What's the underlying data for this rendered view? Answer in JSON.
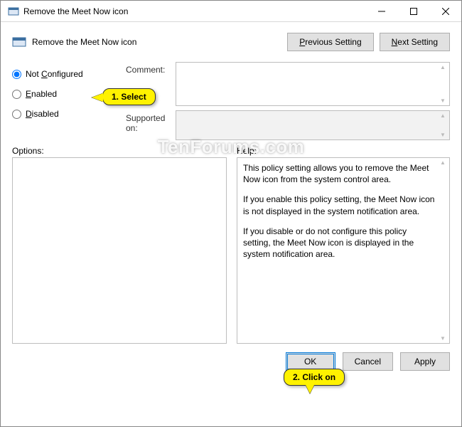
{
  "window": {
    "title": "Remove the Meet Now icon"
  },
  "header": {
    "setting_title": "Remove the Meet Now icon",
    "prev": "Previous Setting",
    "next": "Next Setting"
  },
  "radios": {
    "not_configured": "Not Configured",
    "enabled": "Enabled",
    "disabled": "Disabled",
    "selected": "not_configured"
  },
  "meta": {
    "comment_label": "Comment:",
    "comment_value": "",
    "supported_label": "Supported on:",
    "supported_value": ""
  },
  "panels": {
    "options_label": "Options:",
    "help_label": "Help:",
    "help_paragraphs": [
      "This policy setting allows you to remove the Meet Now icon from the system control area.",
      "If you enable this policy setting, the Meet Now icon is not displayed in the system notification area.",
      "If you disable or do not configure this policy setting, the Meet Now icon is displayed in the system notification area."
    ]
  },
  "buttons": {
    "ok": "OK",
    "cancel": "Cancel",
    "apply": "Apply"
  },
  "callouts": {
    "c1": "1. Select",
    "c2": "2. Click on"
  },
  "watermark": "TenForums.com"
}
